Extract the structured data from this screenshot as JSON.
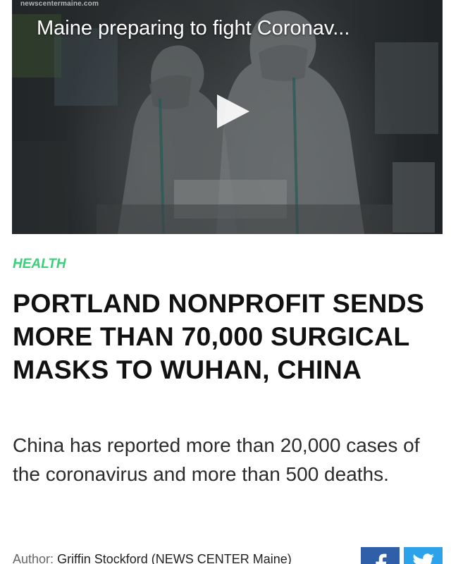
{
  "video": {
    "source": "newscentermaine.com",
    "title": "Maine preparing to fight Coronav..."
  },
  "article": {
    "category": "HEALTH",
    "headline": "PORTLAND NONPROFIT SENDS MORE THAN 70,000 SURGICAL MASKS TO WUHAN, CHINA",
    "summary": "China has reported more than 20,000 cases of the coronavirus and more than 500 deaths."
  },
  "byline": {
    "label": "Author:",
    "name": "Griffin Stockford (NEWS CENTER Maine)"
  },
  "share": {
    "facebook_icon": "facebook-icon",
    "twitter_icon": "twitter-icon"
  },
  "colors": {
    "category": "#3ad07a",
    "facebook": "#2f5fa8",
    "twitter": "#2ba2ea"
  }
}
